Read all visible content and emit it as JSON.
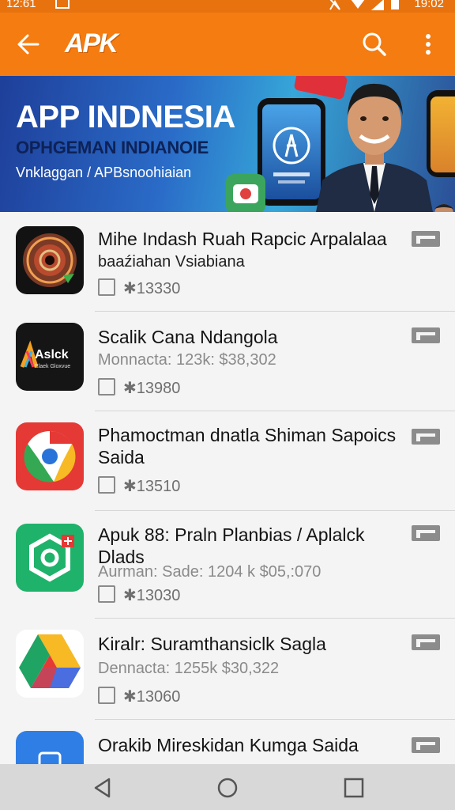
{
  "status_bar": {
    "time_left": "12:61",
    "time_right": "19:02"
  },
  "app_bar": {
    "logo": "APK"
  },
  "banner": {
    "title": "APP INDNESIA",
    "subtitle": "OPHGEMAN INDIANOIE",
    "tagline": "Vnklaggan / APBsnoohiaian"
  },
  "apps": [
    {
      "name": "Mihe Indash Ruah Rapcic Arpalalaa",
      "meta": "baaźiahan Vsiabiana",
      "rating": "✱13330"
    },
    {
      "name": "Scalik Cana Ndangola",
      "meta": "Monnacta: 123k: $38,302",
      "rating": "✱13980",
      "icon_text": "Aslck",
      "icon_subtext": "Elaek Gloxvue"
    },
    {
      "name": "Phamoctman dnatla Shiman Sapoics Saida",
      "meta": "",
      "rating": "✱13510"
    },
    {
      "name": "Apuk 88: Praln Planbias / Aplalck Dlads",
      "meta": "Aurman: Sade: 1204 k $05,:070",
      "rating": "✱13030"
    },
    {
      "name": "Kiralr: Suramthansiclk Sagla",
      "meta": "Dennacta: 1255k $30,322",
      "rating": "✱13060"
    },
    {
      "name": "Orakib Mireskidan Kumga Saida",
      "meta": "",
      "rating": ""
    }
  ],
  "colors": {
    "app_bar": "#f57c10",
    "status_bar": "#e8720e",
    "banner_blue": "#2a6cc8"
  }
}
